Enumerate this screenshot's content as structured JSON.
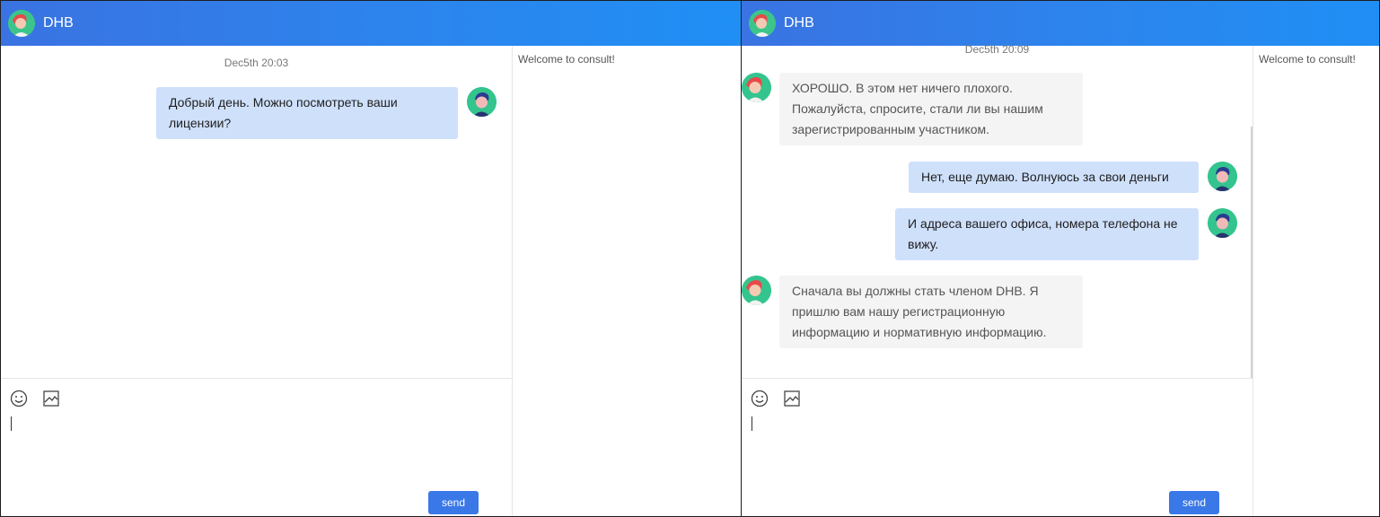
{
  "colors": {
    "header_start": "#3a73e2",
    "header_end": "#1f8ff5",
    "outgoing_bubble": "#cfe0fb",
    "incoming_bubble": "#f4f4f4",
    "send_button": "#3a78e8"
  },
  "left": {
    "header": {
      "title": "DHB"
    },
    "timestamp": "Dec5th 20:03",
    "messages": [
      {
        "direction": "out",
        "text": "Добрый день. Можно посмотреть ваши лицензии?"
      }
    ],
    "sidebar": {
      "welcome": "Welcome to consult!"
    },
    "composer": {
      "send_label": "send"
    }
  },
  "right": {
    "header": {
      "title": "DHB"
    },
    "timestamp": "Dec5th 20:09",
    "messages": [
      {
        "direction": "in",
        "text": "ХОРОШО. В этом нет ничего плохого. Пожалуйста, спросите, стали ли вы нашим зарегистрированным участником."
      },
      {
        "direction": "out",
        "text": "Нет, еще думаю. Волнуюсь за свои деньги"
      },
      {
        "direction": "out",
        "text": "И адреса вашего офиса, номера телефона не вижу."
      },
      {
        "direction": "in",
        "text": "Сначала вы должны стать членом DHB. Я пришлю вам нашу регистрационную информацию и нормативную информацию."
      }
    ],
    "sidebar": {
      "welcome": "Welcome to consult!"
    },
    "composer": {
      "send_label": "send"
    }
  }
}
